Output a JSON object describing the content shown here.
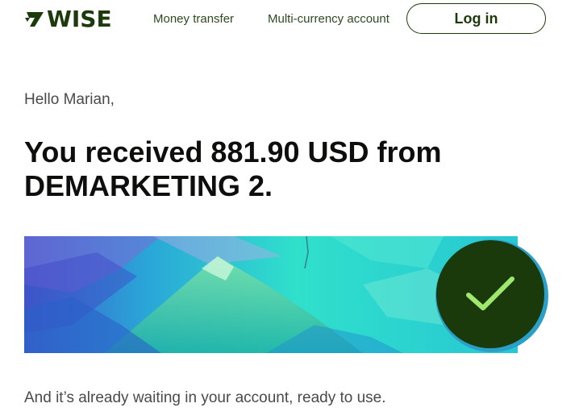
{
  "header": {
    "logo_text": "WISE",
    "logo_icon": "wise-flag-icon",
    "nav": [
      {
        "label": "Money transfer"
      },
      {
        "label": "Multi-currency account"
      }
    ],
    "login_label": "Log in"
  },
  "main": {
    "greeting": "Hello Marian,",
    "headline": "You received 881.90 USD from DEMARKETING 2.",
    "banner_icon": "check-icon",
    "body_text": "And it’s already waiting in your account, ready to use."
  },
  "colors": {
    "brand_dark_green": "#1b3a0b",
    "check_green": "#9fe870",
    "text_gray": "#4a4a4a",
    "headline_black": "#0e0f0c"
  }
}
